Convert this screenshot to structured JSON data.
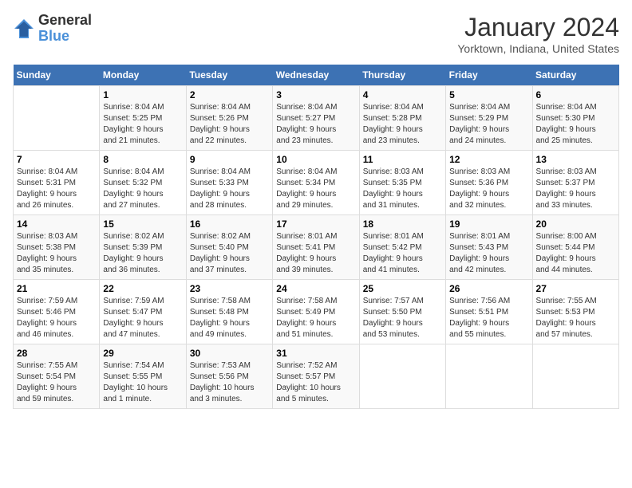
{
  "header": {
    "logo_line1": "General",
    "logo_line2": "Blue",
    "title": "January 2024",
    "subtitle": "Yorktown, Indiana, United States"
  },
  "calendar": {
    "days_of_week": [
      "Sunday",
      "Monday",
      "Tuesday",
      "Wednesday",
      "Thursday",
      "Friday",
      "Saturday"
    ],
    "weeks": [
      [
        {
          "day": "",
          "info": ""
        },
        {
          "day": "1",
          "info": "Sunrise: 8:04 AM\nSunset: 5:25 PM\nDaylight: 9 hours\nand 21 minutes."
        },
        {
          "day": "2",
          "info": "Sunrise: 8:04 AM\nSunset: 5:26 PM\nDaylight: 9 hours\nand 22 minutes."
        },
        {
          "day": "3",
          "info": "Sunrise: 8:04 AM\nSunset: 5:27 PM\nDaylight: 9 hours\nand 23 minutes."
        },
        {
          "day": "4",
          "info": "Sunrise: 8:04 AM\nSunset: 5:28 PM\nDaylight: 9 hours\nand 23 minutes."
        },
        {
          "day": "5",
          "info": "Sunrise: 8:04 AM\nSunset: 5:29 PM\nDaylight: 9 hours\nand 24 minutes."
        },
        {
          "day": "6",
          "info": "Sunrise: 8:04 AM\nSunset: 5:30 PM\nDaylight: 9 hours\nand 25 minutes."
        }
      ],
      [
        {
          "day": "7",
          "info": "Sunrise: 8:04 AM\nSunset: 5:31 PM\nDaylight: 9 hours\nand 26 minutes."
        },
        {
          "day": "8",
          "info": "Sunrise: 8:04 AM\nSunset: 5:32 PM\nDaylight: 9 hours\nand 27 minutes."
        },
        {
          "day": "9",
          "info": "Sunrise: 8:04 AM\nSunset: 5:33 PM\nDaylight: 9 hours\nand 28 minutes."
        },
        {
          "day": "10",
          "info": "Sunrise: 8:04 AM\nSunset: 5:34 PM\nDaylight: 9 hours\nand 29 minutes."
        },
        {
          "day": "11",
          "info": "Sunrise: 8:03 AM\nSunset: 5:35 PM\nDaylight: 9 hours\nand 31 minutes."
        },
        {
          "day": "12",
          "info": "Sunrise: 8:03 AM\nSunset: 5:36 PM\nDaylight: 9 hours\nand 32 minutes."
        },
        {
          "day": "13",
          "info": "Sunrise: 8:03 AM\nSunset: 5:37 PM\nDaylight: 9 hours\nand 33 minutes."
        }
      ],
      [
        {
          "day": "14",
          "info": "Sunrise: 8:03 AM\nSunset: 5:38 PM\nDaylight: 9 hours\nand 35 minutes."
        },
        {
          "day": "15",
          "info": "Sunrise: 8:02 AM\nSunset: 5:39 PM\nDaylight: 9 hours\nand 36 minutes."
        },
        {
          "day": "16",
          "info": "Sunrise: 8:02 AM\nSunset: 5:40 PM\nDaylight: 9 hours\nand 37 minutes."
        },
        {
          "day": "17",
          "info": "Sunrise: 8:01 AM\nSunset: 5:41 PM\nDaylight: 9 hours\nand 39 minutes."
        },
        {
          "day": "18",
          "info": "Sunrise: 8:01 AM\nSunset: 5:42 PM\nDaylight: 9 hours\nand 41 minutes."
        },
        {
          "day": "19",
          "info": "Sunrise: 8:01 AM\nSunset: 5:43 PM\nDaylight: 9 hours\nand 42 minutes."
        },
        {
          "day": "20",
          "info": "Sunrise: 8:00 AM\nSunset: 5:44 PM\nDaylight: 9 hours\nand 44 minutes."
        }
      ],
      [
        {
          "day": "21",
          "info": "Sunrise: 7:59 AM\nSunset: 5:46 PM\nDaylight: 9 hours\nand 46 minutes."
        },
        {
          "day": "22",
          "info": "Sunrise: 7:59 AM\nSunset: 5:47 PM\nDaylight: 9 hours\nand 47 minutes."
        },
        {
          "day": "23",
          "info": "Sunrise: 7:58 AM\nSunset: 5:48 PM\nDaylight: 9 hours\nand 49 minutes."
        },
        {
          "day": "24",
          "info": "Sunrise: 7:58 AM\nSunset: 5:49 PM\nDaylight: 9 hours\nand 51 minutes."
        },
        {
          "day": "25",
          "info": "Sunrise: 7:57 AM\nSunset: 5:50 PM\nDaylight: 9 hours\nand 53 minutes."
        },
        {
          "day": "26",
          "info": "Sunrise: 7:56 AM\nSunset: 5:51 PM\nDaylight: 9 hours\nand 55 minutes."
        },
        {
          "day": "27",
          "info": "Sunrise: 7:55 AM\nSunset: 5:53 PM\nDaylight: 9 hours\nand 57 minutes."
        }
      ],
      [
        {
          "day": "28",
          "info": "Sunrise: 7:55 AM\nSunset: 5:54 PM\nDaylight: 9 hours\nand 59 minutes."
        },
        {
          "day": "29",
          "info": "Sunrise: 7:54 AM\nSunset: 5:55 PM\nDaylight: 10 hours\nand 1 minute."
        },
        {
          "day": "30",
          "info": "Sunrise: 7:53 AM\nSunset: 5:56 PM\nDaylight: 10 hours\nand 3 minutes."
        },
        {
          "day": "31",
          "info": "Sunrise: 7:52 AM\nSunset: 5:57 PM\nDaylight: 10 hours\nand 5 minutes."
        },
        {
          "day": "",
          "info": ""
        },
        {
          "day": "",
          "info": ""
        },
        {
          "day": "",
          "info": ""
        }
      ]
    ]
  }
}
